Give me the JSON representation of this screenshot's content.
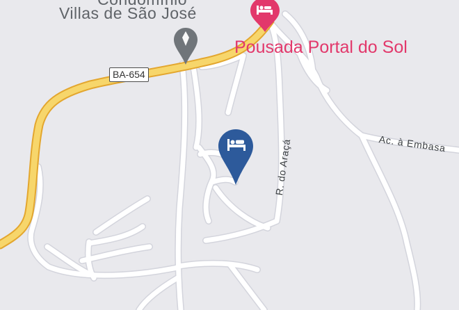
{
  "map": {
    "colors": {
      "background": "#e9e9ed",
      "local_road": "#ffffff",
      "road_casing": "#d3d4dc",
      "highway_fill": "#f7d66b",
      "highway_casing": "#e3a62e",
      "hotel_pin": "#2d5a9b",
      "lodging_poi": "#e2386b",
      "place_pin": "#70757a"
    },
    "labels": {
      "condominium_line1": "Condomínio",
      "condominium_line2": "Villas de São José",
      "lodging": "Pousada Portal do Sol",
      "highway_shield": "BA-654",
      "street_embasa": "Ac. à Embasa",
      "street_araca": "R. do Araçá"
    },
    "pins": {
      "hotel": "hotel-bed-icon",
      "lodging": "bed-icon",
      "place": "location-pin-icon"
    }
  }
}
